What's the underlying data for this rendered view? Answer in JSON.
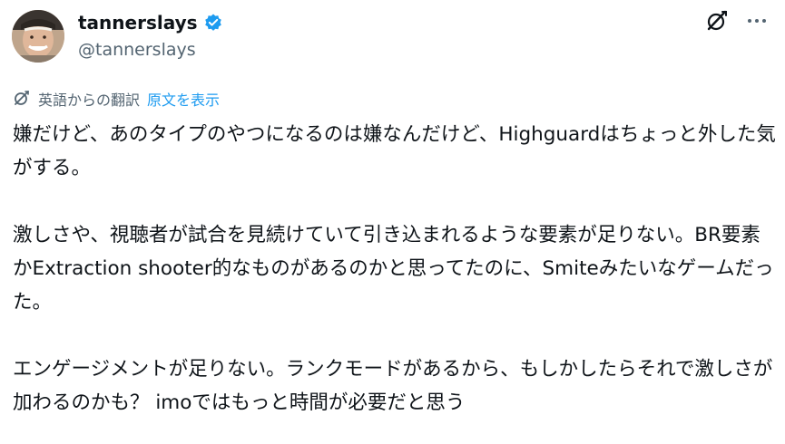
{
  "user": {
    "display_name": "tannerslays",
    "handle": "@tannerslays"
  },
  "translation": {
    "label": "英語からの翻訳",
    "show_original": "原文を表示"
  },
  "tweet": {
    "paragraphs": [
      "嫌だけど、あのタイプのやつになるのは嫌なんだけど、Highguardはちょっと外した気がする。",
      "激しさや、視聴者が試合を見続けていて引き込まれるような要素が足りない。BR要素かExtraction shooter的なものがあるのかと思ってたのに、Smiteみたいなゲームだった。",
      "エンゲージメントが足りない。ランクモードがあるから、もしかしたらそれで激しさが加わるのかも？ imoではもっと時間が必要だと思う"
    ]
  },
  "colors": {
    "text": "#0f1419",
    "secondary": "#536471",
    "link": "#1d9bf0",
    "verified": "#1d9bf0"
  },
  "icons": {
    "verified": "verified-badge-icon",
    "grok": "grok-icon",
    "more": "more-icon",
    "translate": "translate-icon"
  }
}
